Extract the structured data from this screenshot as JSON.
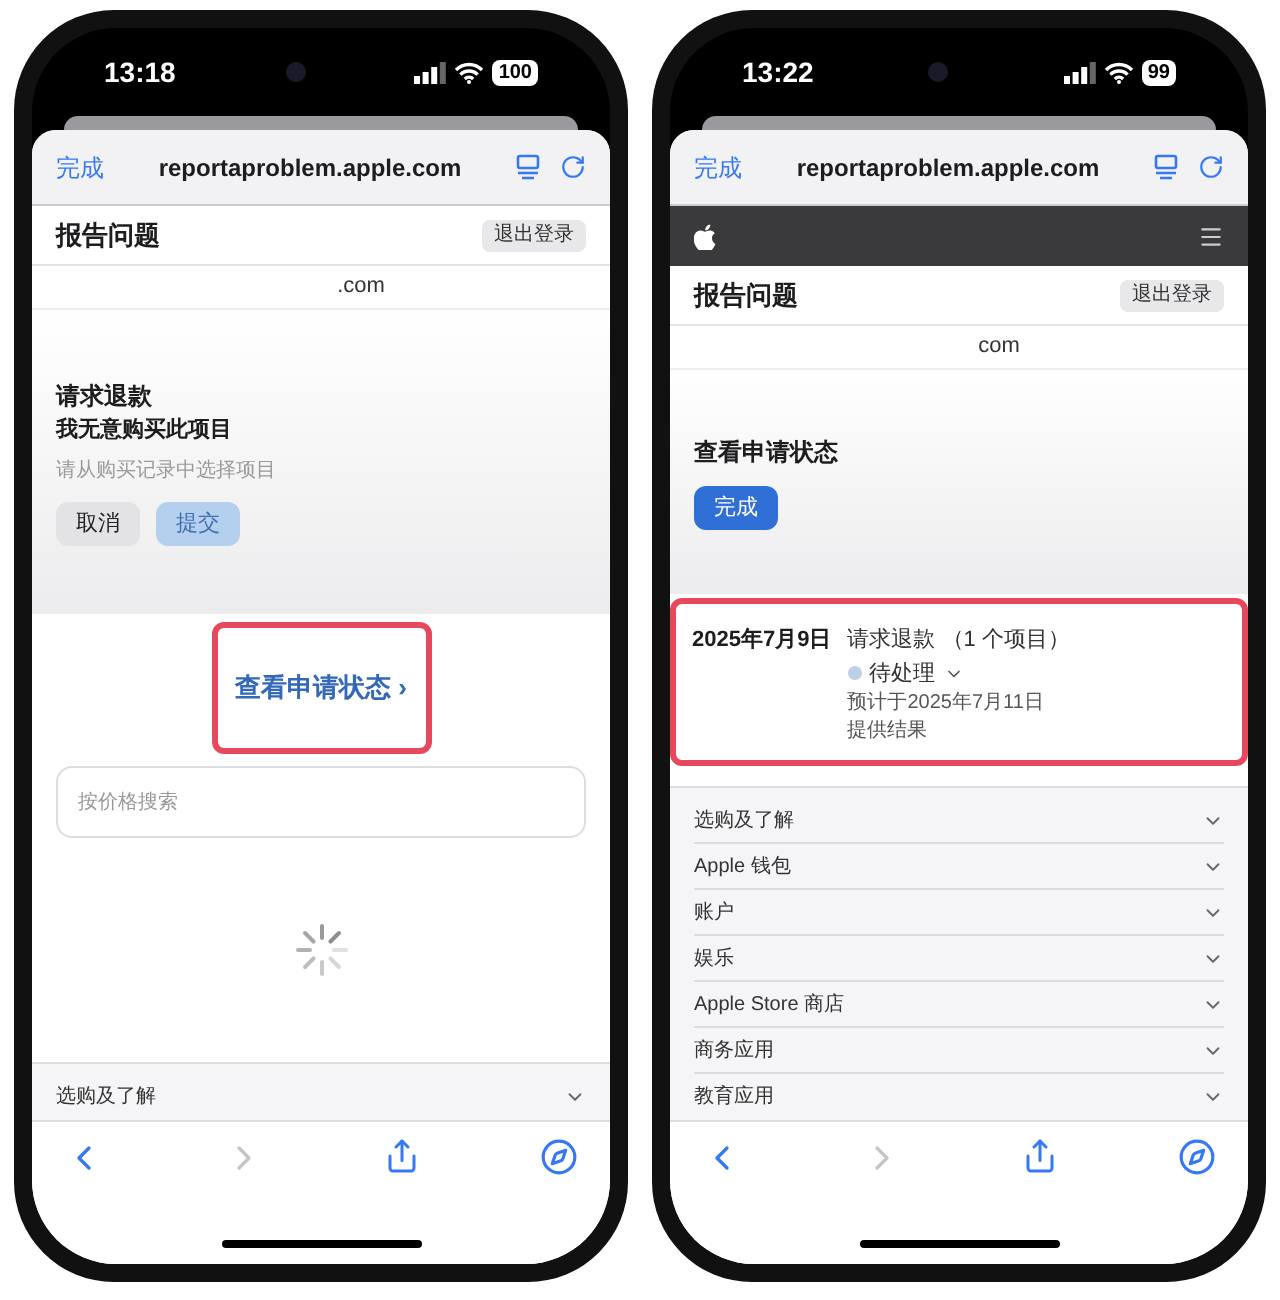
{
  "phones": [
    {
      "status_bar": {
        "time": "13:18",
        "battery": "100"
      },
      "browser": {
        "done": "完成",
        "url": "reportaproblem.apple.com"
      },
      "sections": [
        {
          "kind": "header",
          "title": "报告问题",
          "button": "退出登录"
        },
        {
          "kind": "account",
          "text": ".com"
        },
        {
          "kind": "refund_form",
          "title": "请求退款",
          "reason": "我无意购买此项目",
          "hint": "请从购买记录中选择项目",
          "buttons": [
            {
              "label": "取消",
              "disabled": false
            },
            {
              "label": "提交",
              "disabled": true
            }
          ]
        },
        {
          "kind": "status_link",
          "text": "查看申请状态",
          "arrow": "›",
          "highlighted": true
        },
        {
          "kind": "search",
          "placeholder": "按价格搜索"
        },
        {
          "kind": "loading"
        },
        {
          "kind": "footer",
          "items": [
            "选购及了解"
          ]
        }
      ]
    },
    {
      "status_bar": {
        "time": "13:22",
        "battery": "99"
      },
      "browser": {
        "done": "完成",
        "url": "reportaproblem.apple.com"
      },
      "sections": [
        {
          "kind": "nav"
        },
        {
          "kind": "header",
          "title": "报告问题",
          "button": "退出登录"
        },
        {
          "kind": "account",
          "text": "com"
        },
        {
          "kind": "status_panel",
          "title": "查看申请状态",
          "button": "完成"
        },
        {
          "kind": "request",
          "highlighted": true,
          "date": "2025年7月9日",
          "title": "请求退款 （1 个项目）",
          "status": "待处理",
          "color": "#bcd0e4",
          "note_lines": [
            "预计于2025年7月11日",
            "提供结果"
          ]
        },
        {
          "kind": "footer",
          "items": [
            "选购及了解",
            "Apple 钱包",
            "账户",
            "娱乐",
            "Apple Store 商店",
            "商务应用",
            "教育应用"
          ]
        }
      ]
    }
  ]
}
